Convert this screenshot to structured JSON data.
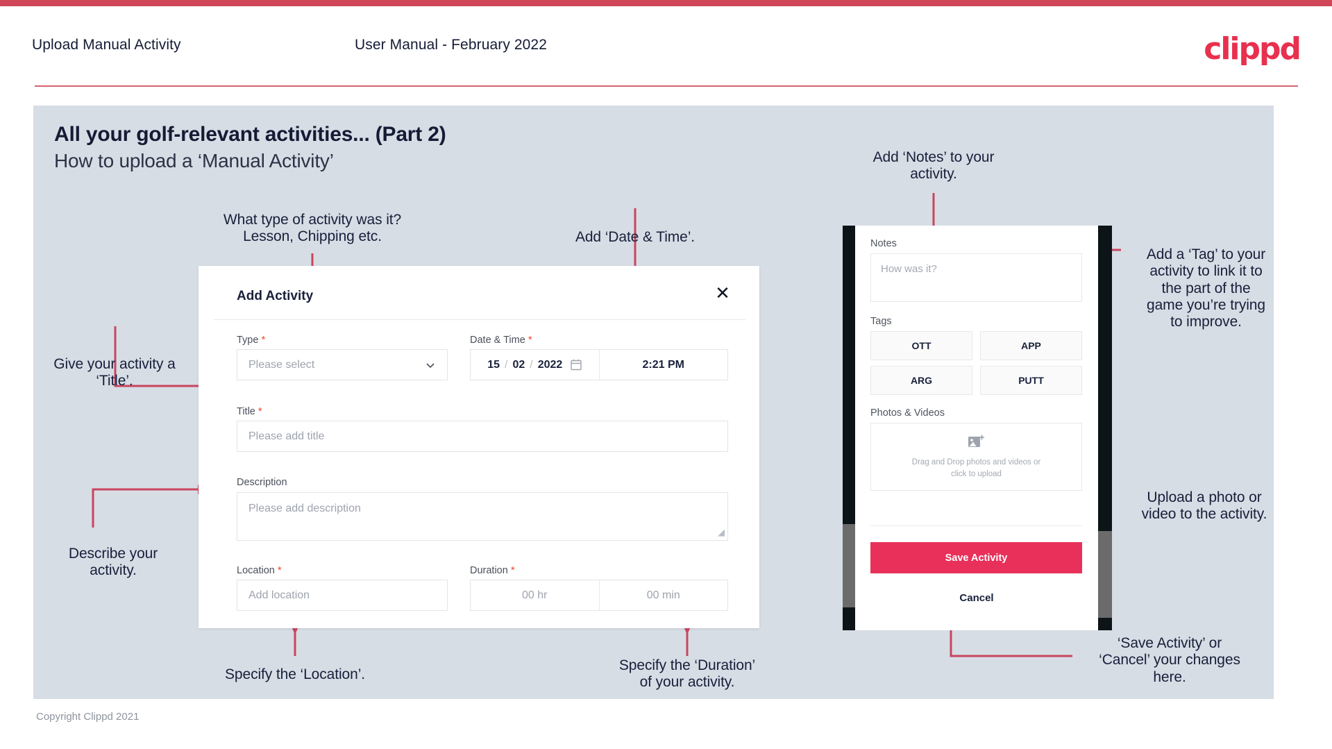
{
  "header": {
    "title": "Upload Manual Activity",
    "subtitle": "User Manual - February 2022",
    "logo": "clippd"
  },
  "slide": {
    "heading": "All your golf-relevant activities... (Part 2)",
    "subheading": "How to upload a ‘Manual Activity’"
  },
  "footer": {
    "copyright": "Copyright Clippd 2021"
  },
  "annotations": {
    "type": "What type of activity was it?\nLesson, Chipping etc.",
    "datetime": "Add ‘Date & Time’.",
    "title": "Give your activity a\n‘Title’.",
    "description": "Describe your\nactivity.",
    "location": "Specify the ‘Location’.",
    "duration": "Specify the ‘Duration’\nof your activity.",
    "notes": "Add ‘Notes’ to your\nactivity.",
    "tags": "Add a ‘Tag’ to your\nactivity to link it to\nthe part of the\ngame you’re trying\nto improve.",
    "photos": "Upload a photo or\nvideo to the activity.",
    "save": "‘Save Activity’ or\n‘Cancel’ your changes\nhere."
  },
  "dialog": {
    "title": "Add Activity",
    "close_icon": "close-icon",
    "fields": {
      "type": {
        "label": "Type",
        "required": "*",
        "placeholder": "Please select",
        "icon": "chevron-down-icon"
      },
      "datetime": {
        "label": "Date & Time",
        "required": "*",
        "day": "15",
        "month": "02",
        "year": "2022",
        "sep": "/",
        "time": "2:21 PM",
        "icon": "calendar-icon"
      },
      "title": {
        "label": "Title",
        "required": "*",
        "placeholder": "Please add title"
      },
      "description": {
        "label": "Description",
        "required": "",
        "placeholder": "Please add description"
      },
      "location": {
        "label": "Location",
        "required": "*",
        "placeholder": "Add location"
      },
      "duration": {
        "label": "Duration",
        "required": "*",
        "hours": "00 hr",
        "minutes": "00 min"
      }
    }
  },
  "phone": {
    "notes": {
      "label": "Notes",
      "placeholder": "How was it?"
    },
    "tags": {
      "label": "Tags",
      "items": [
        "OTT",
        "APP",
        "ARG",
        "PUTT"
      ]
    },
    "photos": {
      "label": "Photos & Videos",
      "drop_text": "Drag and Drop photos and videos or\nclick to upload",
      "icon": "add-image-icon"
    },
    "save_label": "Save Activity",
    "cancel_label": "Cancel"
  },
  "colors": {
    "brand_pink": "#e8304f",
    "brand_bar": "#cf4759",
    "save_button": "#e8305a",
    "slide_bg": "#d7dde5",
    "text_dark": "#141b34",
    "required_red": "#f2462e",
    "wire": "#c9455e"
  }
}
